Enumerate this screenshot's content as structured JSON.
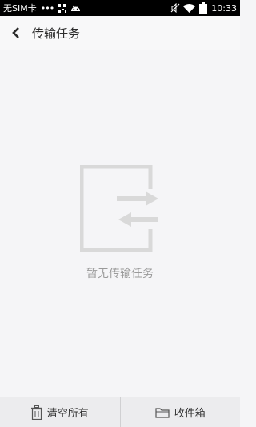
{
  "status_bar": {
    "carrier": "无SIM卡",
    "dots": "•••",
    "time": "10:33",
    "icons": [
      "qr-icon",
      "android-icon",
      "mute-icon",
      "wifi-icon",
      "battery-icon"
    ]
  },
  "header": {
    "back_icon": "back-arrow-icon",
    "title": "传输任务"
  },
  "empty_state": {
    "icon": "transfer-icon",
    "message": "暂无传输任务"
  },
  "bottom_bar": {
    "clear_all": {
      "label": "清空所有",
      "icon": "trash-icon"
    },
    "inbox": {
      "label": "收件箱",
      "icon": "folder-icon"
    }
  },
  "colors": {
    "background": "#f5f5f7",
    "illustration": "#d9d9d9",
    "muted_text": "#9a9a9a"
  }
}
